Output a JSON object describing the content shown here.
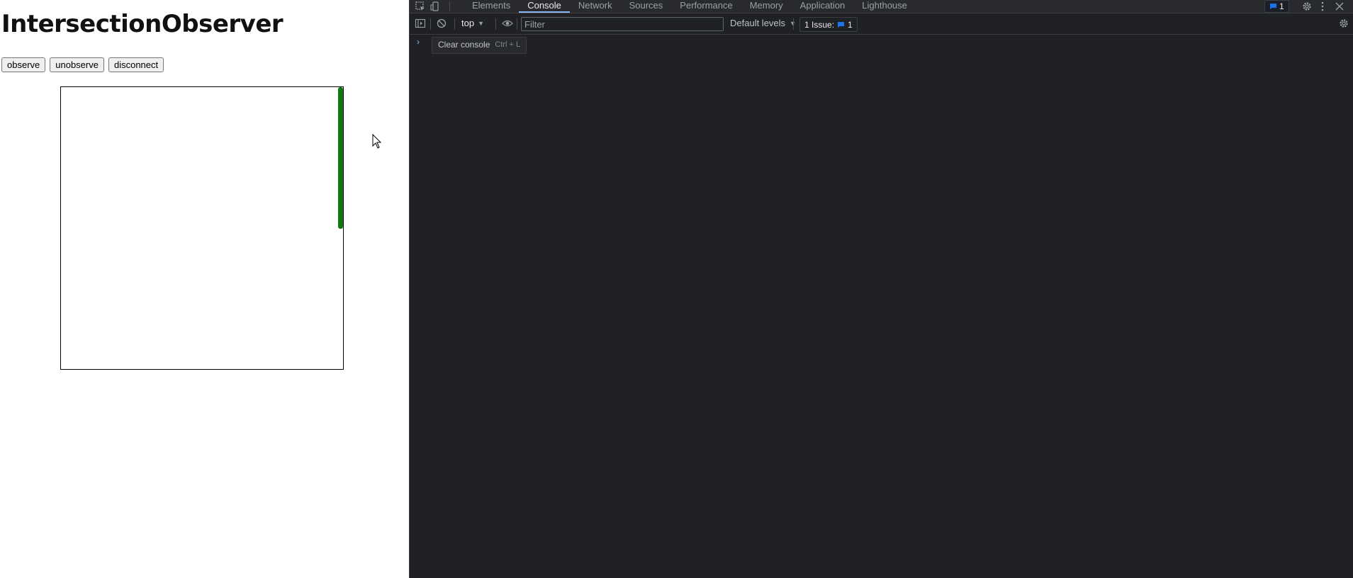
{
  "page": {
    "title": "IntersectionObserver",
    "buttons": {
      "observe": "observe",
      "unobserve": "unobserve",
      "disconnect": "disconnect"
    }
  },
  "devtools": {
    "tabs": [
      "Elements",
      "Console",
      "Network",
      "Sources",
      "Performance",
      "Memory",
      "Application",
      "Lighthouse"
    ],
    "active_tab": "Console",
    "messages_badge_count": "1",
    "console_toolbar": {
      "context": "top",
      "filter_placeholder": "Filter",
      "levels": "Default levels",
      "issues_label": "1 Issue:",
      "issues_count": "1"
    },
    "tooltip": {
      "label": "Clear console",
      "shortcut": "Ctrl + L"
    }
  },
  "colors": {
    "devtools_bg": "#202124",
    "accent_blue": "#8ab4f8",
    "issue_blue": "#1a73e8",
    "scroll_thumb_green": "#0f7a12"
  },
  "icons": [
    "inspect-element-icon",
    "device-toolbar-icon",
    "settings-gear-icon",
    "more-vertical-icon",
    "close-icon",
    "sidebar-toggle-icon",
    "clear-console-icon",
    "eye-icon",
    "message-icon",
    "chevron-right-icon",
    "mouse-cursor-icon"
  ]
}
